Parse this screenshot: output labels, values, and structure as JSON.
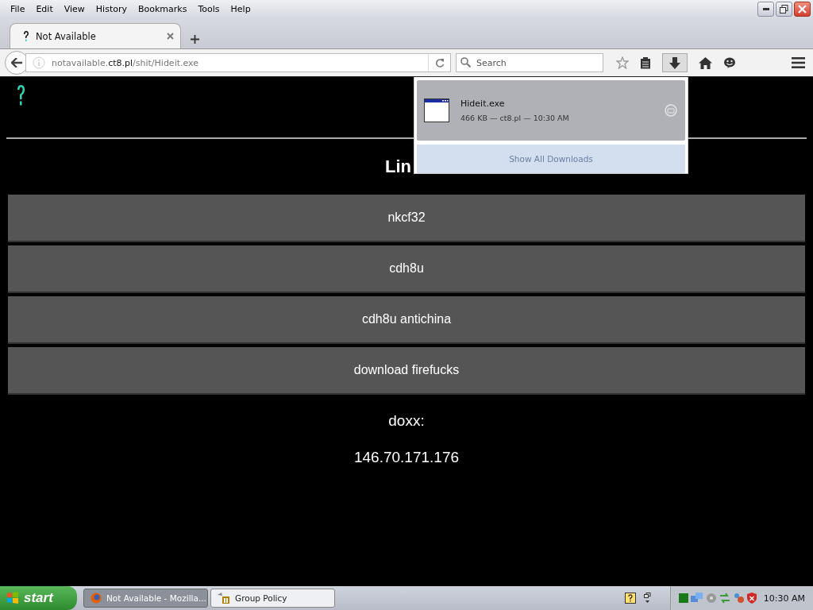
{
  "menu_bar": {
    "items": [
      "File",
      "Edit",
      "View",
      "History",
      "Bookmarks",
      "Tools",
      "Help"
    ]
  },
  "tabs": [
    {
      "label": "Not Available",
      "selected": true
    }
  ],
  "address_bar": {
    "domain_prefix": "notavailable.",
    "domain": "ct8.pl",
    "path": "/shit/Hideit.exe"
  },
  "search": {
    "placeholder": "Search"
  },
  "downloads_panel": {
    "items": [
      {
        "name": "Hideit.exe",
        "details": "466 KB — ct8.pl — 10:30 AM"
      }
    ],
    "footer": "Show All Downloads"
  },
  "page": {
    "heading": "Lin",
    "links": [
      "nkcf32",
      "cdh8u",
      "cdh8u antichina",
      "download firefucks"
    ],
    "label": "doxx:",
    "ip": "146.70.171.176"
  },
  "taskbar": {
    "start": "start",
    "tasks": [
      {
        "label": "Not Available - Mozilla...",
        "selected": true,
        "kind": "firefox"
      },
      {
        "label": "Group Policy",
        "selected": false,
        "kind": "policy"
      }
    ],
    "clock": "10:30 AM"
  }
}
